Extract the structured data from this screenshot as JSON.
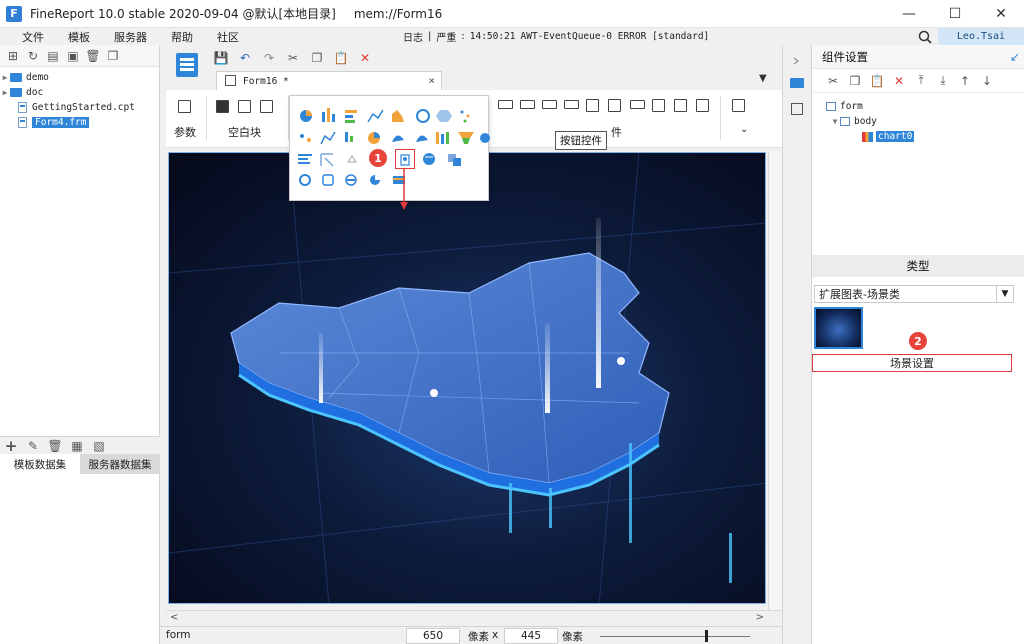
{
  "window": {
    "title": "FineReport 10.0 stable 2020-09-04 @默认[本地目录]",
    "path": "mem://Form16",
    "min_glyph": "—",
    "max_glyph": "☐",
    "close_glyph": "✕"
  },
  "menu": {
    "items": [
      "文件",
      "模板",
      "服务器",
      "帮助",
      "社区"
    ],
    "log_label": "日志",
    "log_level": "严重",
    "log_time": "14:50:21",
    "log_message": "AWT-EventQueue-0 ERROR [standard]"
  },
  "user": {
    "name": "Leo.Tsai"
  },
  "file_tree": {
    "items": [
      {
        "label": "demo",
        "kind": "folder"
      },
      {
        "label": "doc",
        "kind": "folder"
      },
      {
        "label": "GettingStarted.cpt",
        "kind": "file"
      },
      {
        "label": "Form4.frm",
        "kind": "file",
        "selected": true
      }
    ]
  },
  "datasets": {
    "template_tab": "模板数据集",
    "server_tab": "服务器数据集"
  },
  "editor": {
    "tab_label": "Form16 *",
    "tab_close": "×"
  },
  "ribbon": {
    "param_label": "参数",
    "blank_label": "空白块",
    "controls_label": "件",
    "tooltip": "按钮控件"
  },
  "annotations": {
    "badge_1": "1",
    "badge_2": "2"
  },
  "status": {
    "mode": "form",
    "width_value": "650",
    "width_unit": "像素",
    "times": "x",
    "height_value": "445",
    "height_unit": "像素"
  },
  "component_settings": {
    "title": "组件设置",
    "tree": [
      {
        "label": "form",
        "level": 0
      },
      {
        "label": "body",
        "level": 1
      },
      {
        "label": "chart0",
        "level": 2,
        "selected": true
      }
    ],
    "type_header": "类型",
    "type_value": "扩展图表-场景类",
    "scene_button": "场景设置"
  },
  "colors": {
    "accent": "#2f86d8",
    "highlight": "#e03a3a",
    "canvas_bg": "#0d1c3c"
  }
}
